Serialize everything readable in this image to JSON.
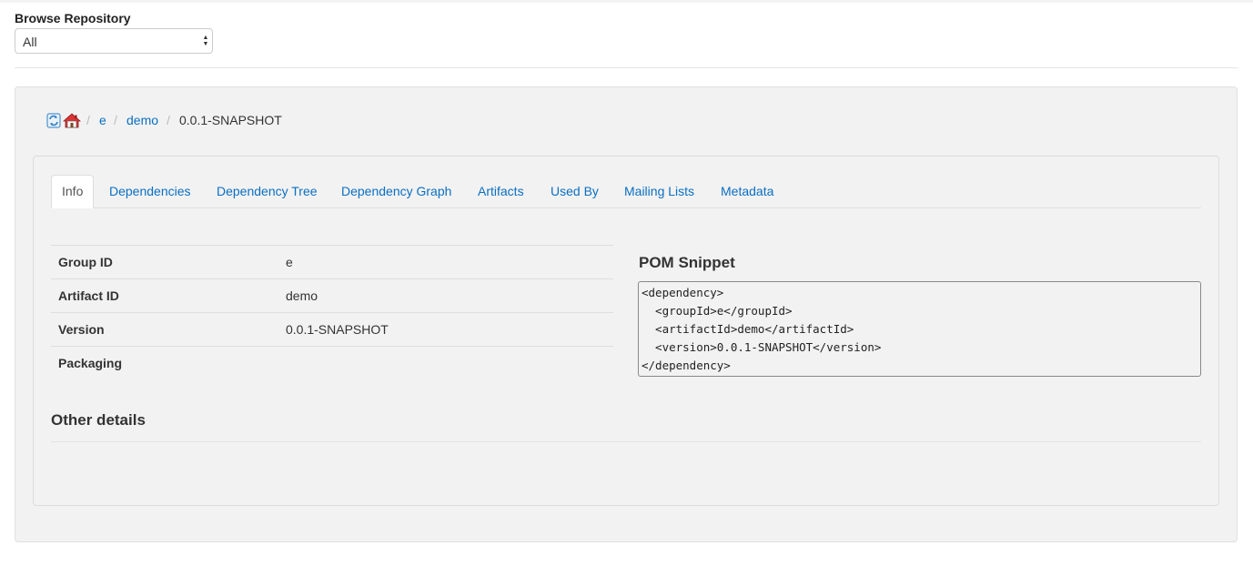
{
  "browse": {
    "label": "Browse Repository",
    "select_value": "All"
  },
  "breadcrumb": {
    "icons": [
      "refresh-icon",
      "home-icon"
    ],
    "items": [
      "e",
      "demo"
    ],
    "separator": "/",
    "current": "0.0.1-SNAPSHOT"
  },
  "tabs": [
    {
      "label": "Info",
      "active": true
    },
    {
      "label": "Dependencies"
    },
    {
      "label": "Dependency Tree"
    },
    {
      "label": "Dependency Graph"
    },
    {
      "label": "Artifacts"
    },
    {
      "label": "Used By"
    },
    {
      "label": "Mailing Lists"
    },
    {
      "label": "Metadata"
    }
  ],
  "info_table": [
    {
      "key": "Group ID",
      "value": "e"
    },
    {
      "key": "Artifact ID",
      "value": "demo"
    },
    {
      "key": "Version",
      "value": "0.0.1-SNAPSHOT"
    },
    {
      "key": "Packaging",
      "value": ""
    }
  ],
  "pom": {
    "title": "POM Snippet",
    "snippet": "<dependency>\n  <groupId>e</groupId>\n  <artifactId>demo</artifactId>\n  <version>0.0.1-SNAPSHOT</version>\n</dependency>"
  },
  "other_details": {
    "title": "Other details"
  },
  "colors": {
    "link": "#0a6fc2",
    "panel_bg": "#f2f2f2"
  }
}
